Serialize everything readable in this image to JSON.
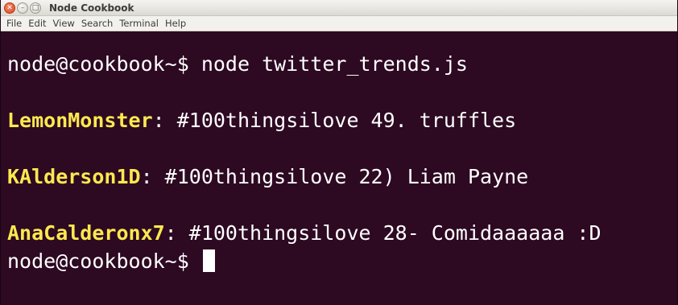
{
  "window": {
    "title": "Node Cookbook",
    "buttons": {
      "close_glyph": "✕",
      "minimize_glyph": "–",
      "maximize_glyph": "□"
    }
  },
  "menu": [
    "File",
    "Edit",
    "View",
    "Search",
    "Terminal",
    "Help"
  ],
  "terminal": {
    "prompt_1": "node@cookbook~$ ",
    "command_1": "node twitter_trends.js",
    "tweets": [
      {
        "user": "LemonMonster",
        "text": ": #100thingsilove 49. truffles"
      },
      {
        "user": "KAlderson1D",
        "text": ": #100thingsilove 22) Liam Payne"
      },
      {
        "user": "AnaCalderonx7",
        "text": ": #100thingsilove 28- Comidaaaaaa :D"
      }
    ],
    "prompt_2": "node@cookbook~$ "
  },
  "colors": {
    "terminal_bg": "#2d0922",
    "terminal_fg": "#ffffff",
    "username": "#fce94f",
    "close_button": "#e0471b"
  }
}
